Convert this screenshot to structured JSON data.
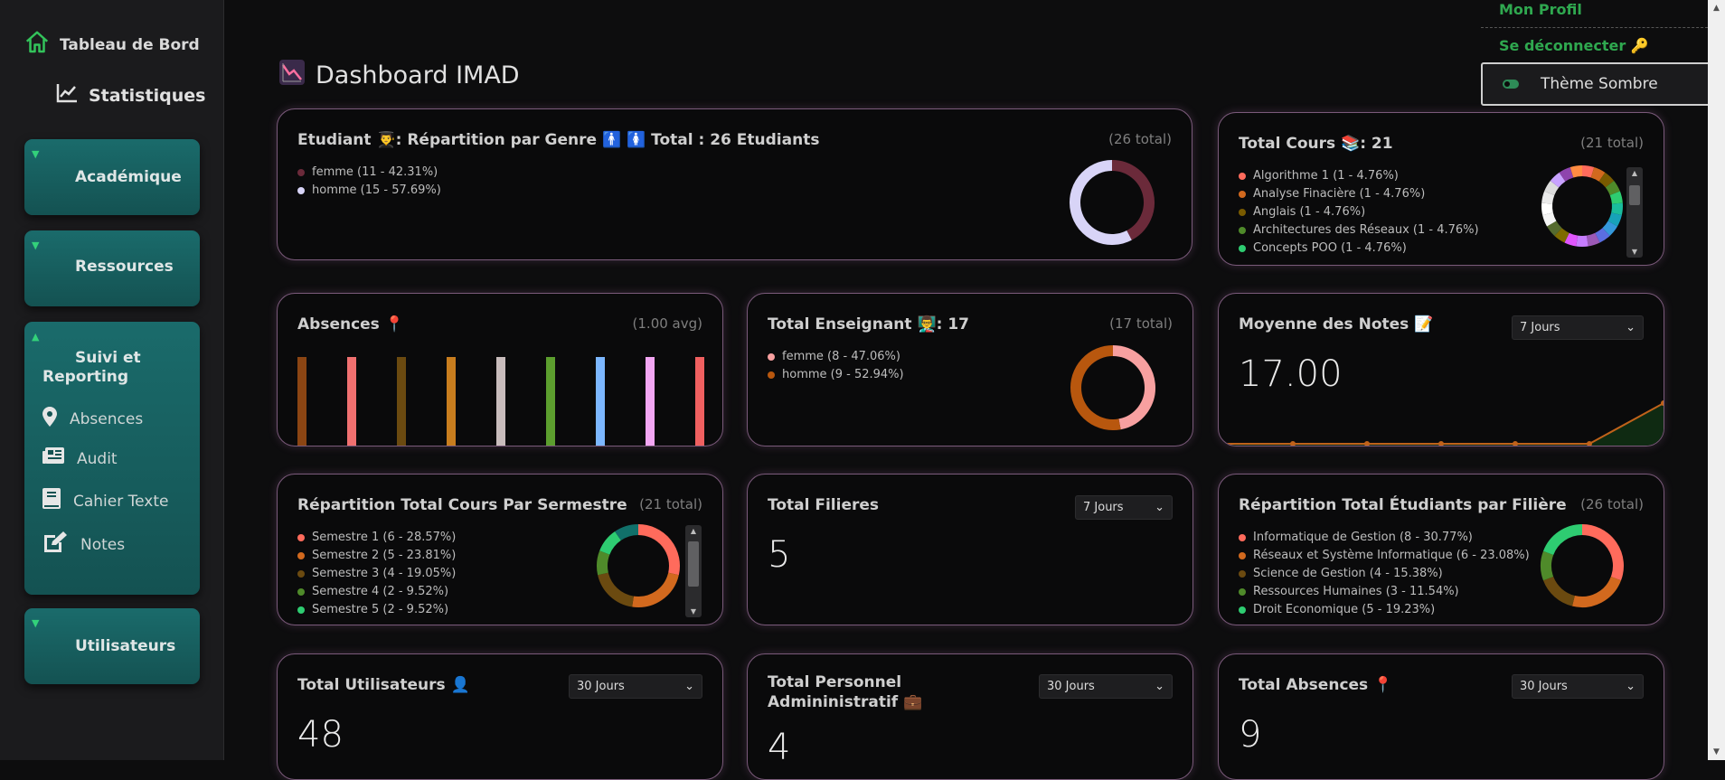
{
  "sidebar": {
    "home_label": "Tableau de Bord",
    "stats_label": "Statistiques",
    "sections": [
      {
        "label": "Académique",
        "arrow": "▼"
      },
      {
        "label": "Ressources",
        "arrow": "▼"
      },
      {
        "label": "Suivi et Reporting",
        "arrow": "▲",
        "items": [
          {
            "label": "Absences",
            "icon": "pin-icon"
          },
          {
            "label": "Audit",
            "icon": "newspaper-icon"
          },
          {
            "label": "Cahier Texte",
            "icon": "book-icon"
          },
          {
            "label": "Notes",
            "icon": "edit-icon"
          }
        ]
      },
      {
        "label": "Utilisateurs",
        "arrow": "▼"
      }
    ]
  },
  "header": {
    "title": "Dashboard IMAD",
    "profile_label": "Mon Profil",
    "logout_label": "Se déconnecter 🔑",
    "theme_label": "Thème Sombre"
  },
  "cards": {
    "students_gender": {
      "title": "Etudiant 👨‍🎓: Répartition par Genre 🚹 🚺 Total : 26 Etudiants",
      "total": "(26 total)",
      "legend": [
        "femme (11 - 42.31%)",
        "homme (15 - 57.69%)"
      ],
      "values": [
        11,
        15
      ],
      "colors": [
        "#6b2a3a",
        "#d8d4f7"
      ]
    },
    "total_courses": {
      "title": "Total Cours 📚: 21",
      "total": "(21 total)",
      "legend": [
        "Algorithme 1 (1 - 4.76%)",
        "Analyse Finacière (1 - 4.76%)",
        "Anglais (1 - 4.76%)",
        "Architectures des Réseaux (1 - 4.76%)",
        "Concepts POO (1 - 4.76%)"
      ],
      "legend_colors": [
        "#ff6b5c",
        "#d2691e",
        "#7a5b00",
        "#4f8a2a",
        "#2ecc71"
      ],
      "ring_colors": [
        "#ff6b5c",
        "#d2691e",
        "#7a5b00",
        "#4f8a2a",
        "#2ecc71",
        "#1abc9c",
        "#17a2b8",
        "#3498db",
        "#5b6ee1",
        "#9b59b6",
        "#c77dff",
        "#e056fd",
        "#7e6b00",
        "#556b2f",
        "#f5f5f5",
        "#ffffff",
        "#eaeaea",
        "#dcdcdc",
        "#c8a2ff",
        "#8e44ad",
        "#ff8c42"
      ],
      "values": [
        1,
        1,
        1,
        1,
        1,
        1,
        1,
        1,
        1,
        1,
        1,
        1,
        1,
        1,
        1,
        1,
        1,
        1,
        1,
        1,
        1
      ]
    },
    "absences": {
      "title": "Absences 📍",
      "total": "(1.00 avg)",
      "bar_colors": [
        "#8b4513",
        "#f07070",
        "#6b4a10",
        "#c87d1e",
        "#c8bcbc",
        "#5c9e2e",
        "#7cb7ff",
        "#f3a6f3",
        "#f06060"
      ],
      "values": [
        1,
        1,
        1,
        1,
        1,
        1,
        1,
        1,
        1
      ]
    },
    "teachers": {
      "title": "Total Enseignant 👨‍🏫: 17",
      "total": "(17 total)",
      "legend": [
        "femme (8 - 47.06%)",
        "homme (9 - 52.94%)"
      ],
      "values": [
        8,
        9
      ],
      "colors": [
        "#f7a0a0",
        "#b8570e"
      ]
    },
    "grades": {
      "title": "Moyenne des Notes 📝",
      "period": "7 Jours",
      "value": "17.00"
    },
    "courses_semester": {
      "title": "Répartition Total Cours Par Sermestre",
      "total": "(21 total)",
      "legend": [
        "Semestre 1 (6 - 28.57%)",
        "Semestre 2 (5 - 23.81%)",
        "Semestre 3 (4 - 19.05%)",
        "Semestre 4 (2 - 9.52%)",
        "Semestre 5 (2 - 9.52%)"
      ],
      "legend_colors": [
        "#ff6b5c",
        "#d2691e",
        "#6b4a10",
        "#4f8a2a",
        "#2ecc71"
      ],
      "values": [
        6,
        5,
        4,
        2,
        2,
        2
      ],
      "ring_colors": [
        "#ff6b5c",
        "#d2691e",
        "#6b4a10",
        "#4f8a2a",
        "#2ecc71",
        "#11706a"
      ]
    },
    "filieres": {
      "title": "Total Filieres",
      "period": "7 Jours",
      "value": "5"
    },
    "students_filiere": {
      "title": "Répartition Total Étudiants par Filière",
      "total": "(26 total)",
      "legend": [
        "Informatique de Gestion (8 - 30.77%)",
        "Réseaux et Système Informatique (6 - 23.08%)",
        "Science de Gestion (4 - 15.38%)",
        "Ressources Humaines (3 - 11.54%)",
        "Droit Economique (5 - 19.23%)"
      ],
      "colors": [
        "#ff6b5c",
        "#d2691e",
        "#6b4a10",
        "#4f8a2a",
        "#2ecc71"
      ],
      "values": [
        8,
        6,
        4,
        3,
        5
      ]
    },
    "users": {
      "title": "Total Utilisateurs 👤",
      "period": "30 Jours",
      "value": "48"
    },
    "admin_staff": {
      "title": "Total Personnel Admininistratif 💼",
      "period": "30 Jours",
      "value": "4"
    },
    "total_absences": {
      "title": "Total Absences 📍",
      "period": "30 Jours",
      "value": "9"
    }
  }
}
